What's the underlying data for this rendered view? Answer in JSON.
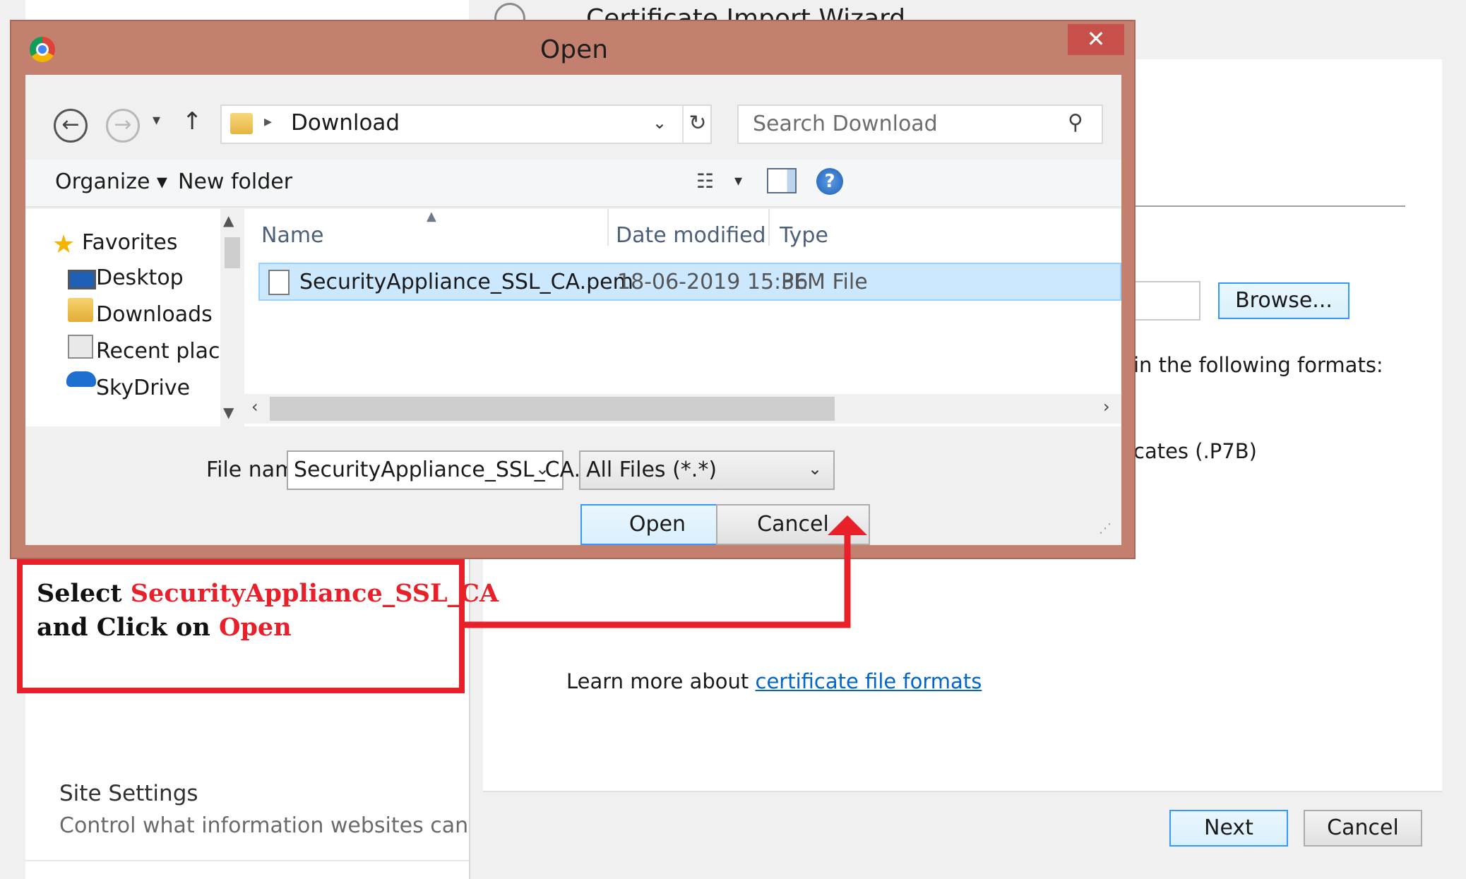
{
  "background_page": {
    "section_title": "Site Settings",
    "section_subtitle": "Control what information websites can use a"
  },
  "wizard": {
    "title": "Certificate Import Wizard",
    "browse_label": "Browse...",
    "formats_text": "in the following formats:",
    "p7b_text": "cates (.P7B)",
    "learn_prefix": "Learn more about ",
    "learn_link": "certificate file formats",
    "next_label": "Next",
    "cancel_label": "Cancel"
  },
  "dialog": {
    "title": "Open",
    "close_glyph": "✕",
    "address": {
      "separator": "▸",
      "folder": "Download",
      "dropdown_glyph": "⌄",
      "refresh_glyph": "↻"
    },
    "search": {
      "placeholder": "Search Download",
      "icon_glyph": "⚲"
    },
    "nav": {
      "back_glyph": "←",
      "forward_glyph": "→",
      "recent_glyph": "▾",
      "up_glyph": "↑"
    },
    "toolbar": {
      "organize": "Organize ▾",
      "new_folder": "New folder",
      "view_glyph": "☷",
      "view_drop_glyph": "▾",
      "help_glyph": "?"
    },
    "sidebar": {
      "items": [
        {
          "label": "Favorites",
          "icon": "star-icon"
        },
        {
          "label": "Desktop",
          "icon": "desktop-icon"
        },
        {
          "label": "Downloads",
          "icon": "downloads-folder-icon"
        },
        {
          "label": "Recent places",
          "icon": "recent-places-icon"
        },
        {
          "label": "SkyDrive",
          "icon": "skydrive-cloud-icon"
        }
      ],
      "star_glyph": "★",
      "scroll_up_glyph": "▲",
      "scroll_down_glyph": "▼"
    },
    "columns": {
      "name": "Name",
      "date": "Date modified",
      "type": "Type",
      "sort_glyph": "▲"
    },
    "files": [
      {
        "name": "SecurityAppliance_SSL_CA.pem",
        "date": "18-06-2019 15:36",
        "type": "PEM File"
      }
    ],
    "hscroll": {
      "left_glyph": "‹",
      "right_glyph": "›"
    },
    "file_name_label": "File name:",
    "file_name_value": "SecurityAppliance_SSL_CA.pem",
    "file_name_drop_glyph": "⌄",
    "file_type_value": "All Files (*.*)",
    "file_type_drop_glyph": "⌄",
    "open_label": "Open",
    "cancel_label": "Cancel",
    "grip_glyph": "⋰"
  },
  "annotation": {
    "line1_prefix": "Select  ",
    "line1_highlight": "SecurityAppliance_SSL_CA",
    "line2_prefix": "and Click on ",
    "line2_highlight": "Open"
  },
  "colors": {
    "dialog_frame": "#c4806e",
    "close_button": "#c7504a",
    "selection": "#cce8ff",
    "annotation_red": "#e8202a",
    "link_blue": "#0066cc"
  }
}
